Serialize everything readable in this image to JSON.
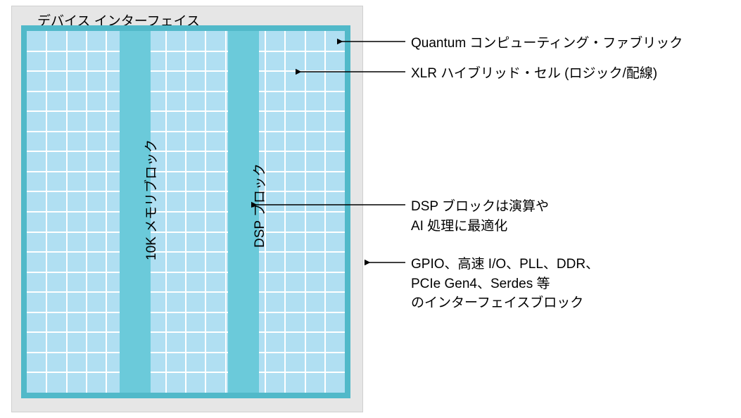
{
  "device": {
    "title": "デバイス インターフェイス",
    "mem_block_label": "10K メモリブロック",
    "dsp_block_label": "DSP ブロック"
  },
  "callouts": {
    "fabric": "Quantum コンピューティング・ファブリック",
    "cell": "XLR ハイブリッド・セル (ロジック/配線)",
    "dsp": "DSP ブロックは演算や\nAI 処理に最適化",
    "io": "GPIO、高速 I/O、PLL、DDR、\nPCIe Gen4、Serdes 等\nのインターフェイスブロック"
  },
  "grid": {
    "cols": 16,
    "rows": 18
  },
  "colors": {
    "outer_bg": "#e6e6e6",
    "fabric_border": "#51b9c9",
    "cell_fill": "#b0dff2",
    "block_fill": "#6bcada",
    "grid_line": "#ffffff"
  }
}
